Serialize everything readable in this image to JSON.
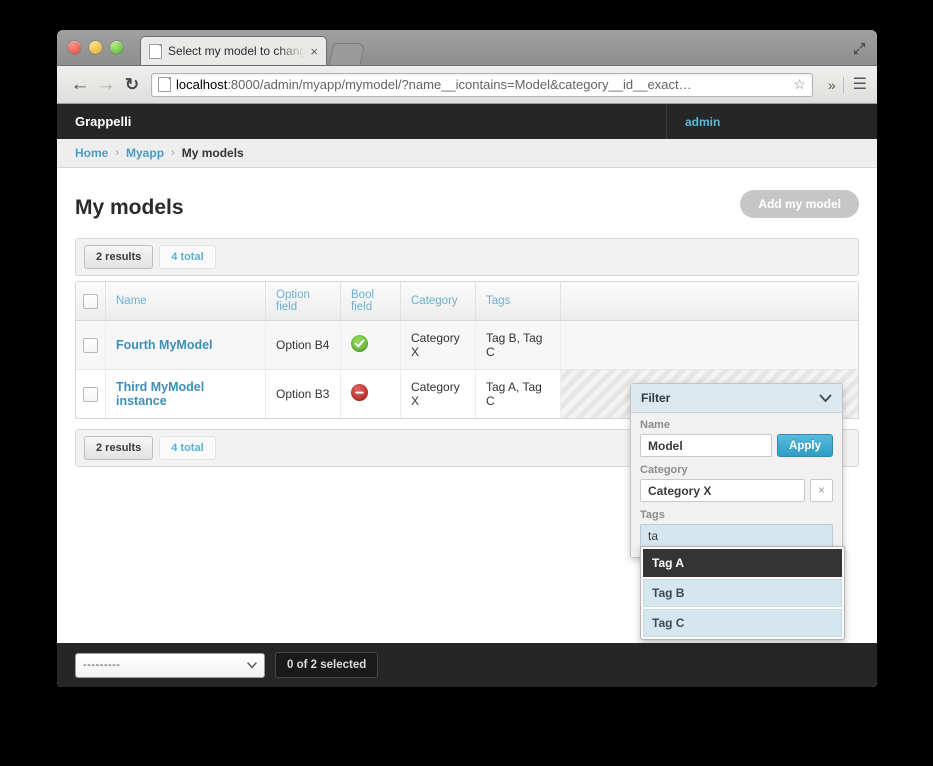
{
  "browser": {
    "tab_title": "Select my model to change",
    "tab_close": "×",
    "back_icon": "←",
    "forward_icon": "→",
    "reload_icon": "↻",
    "url_host": "localhost",
    "url_path": ":8000/admin/myapp/mymodel/?name__icontains=Model&category__id__exact…",
    "star_icon": "☆",
    "more_icon": "»",
    "menu_icon": "☰"
  },
  "header": {
    "brand": "Grappelli",
    "user": "admin"
  },
  "breadcrumb": {
    "home": "Home",
    "app": "Myapp",
    "current": "My models",
    "separator": "›"
  },
  "main": {
    "title": "My models",
    "add_button": "Add my model",
    "toolbar_top": {
      "results": "2 results",
      "total": "4 total"
    },
    "toolbar_bottom": {
      "results": "2 results",
      "total": "4 total"
    }
  },
  "table": {
    "columns": [
      "Name",
      "Option field",
      "Bool field",
      "Category",
      "Tags"
    ],
    "rows": [
      {
        "name": "Fourth MyModel",
        "option": "Option B4",
        "bool": "yes",
        "category": "Category X",
        "tags": "Tag B, Tag C"
      },
      {
        "name": "Third MyModel instance",
        "option": "Option B3",
        "bool": "no",
        "category": "Category X",
        "tags": "Tag A, Tag C"
      }
    ]
  },
  "filter": {
    "header": "Filter",
    "chevron": "⌄",
    "name_label": "Name",
    "name_value": "Model",
    "apply_label": "Apply",
    "category_label": "Category",
    "category_value": "Category X",
    "clear_icon": "×",
    "tags_label": "Tags",
    "tags_value": "ta",
    "suggestions": [
      "Tag A",
      "Tag B",
      "Tag C"
    ]
  },
  "actions": {
    "select_value": "---------",
    "select_chevron": "⌄",
    "selected_count": "0 of 2 selected"
  },
  "colors": {
    "accent": "#5bb9dd",
    "link": "#3d8fb8",
    "bool_yes": "#5aa72c",
    "bool_no": "#b01c1c",
    "apply": "#2f9dc4",
    "dark_bar": "#262626",
    "filter_head": "#dbe8ef"
  }
}
